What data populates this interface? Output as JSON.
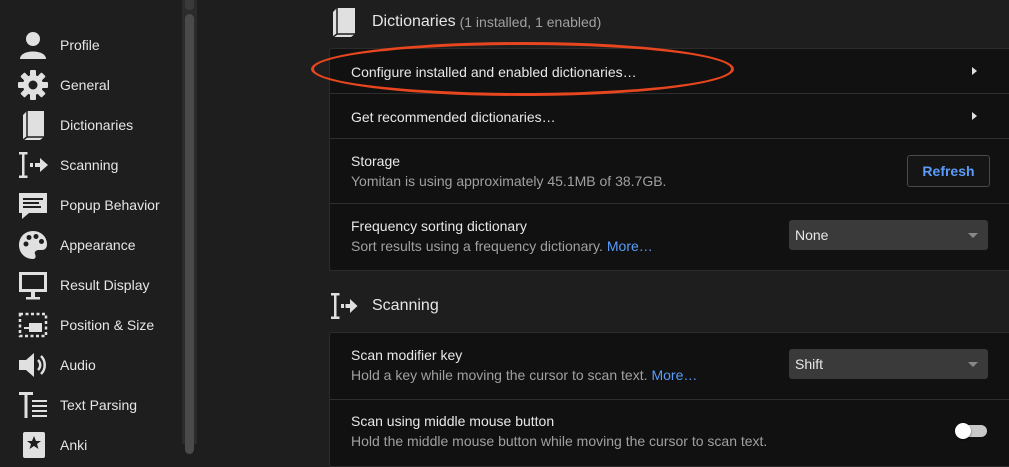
{
  "sidebar": {
    "items": [
      {
        "label": "Profile",
        "icon": "profile-icon"
      },
      {
        "label": "General",
        "icon": "gear-icon"
      },
      {
        "label": "Dictionaries",
        "icon": "book-icon"
      },
      {
        "label": "Scanning",
        "icon": "scanning-icon"
      },
      {
        "label": "Popup Behavior",
        "icon": "popup-icon"
      },
      {
        "label": "Appearance",
        "icon": "palette-icon"
      },
      {
        "label": "Result Display",
        "icon": "monitor-icon"
      },
      {
        "label": "Position & Size",
        "icon": "position-icon"
      },
      {
        "label": "Audio",
        "icon": "speaker-icon"
      },
      {
        "label": "Text Parsing",
        "icon": "text-parsing-icon"
      },
      {
        "label": "Anki",
        "icon": "anki-icon"
      }
    ]
  },
  "dictionaries": {
    "title": "Dictionaries",
    "subtitle": "(1 installed, 1 enabled)",
    "configure_label": "Configure installed and enabled dictionaries…",
    "recommended_label": "Get recommended dictionaries…",
    "storage_title": "Storage",
    "storage_desc": "Yomitan is using approximately 45.1MB of 38.7GB.",
    "refresh_label": "Refresh",
    "freq_title": "Frequency sorting dictionary",
    "freq_desc": "Sort results using a frequency dictionary.",
    "freq_more": "More…",
    "freq_value": "None"
  },
  "scanning": {
    "title": "Scanning",
    "modifier_title": "Scan modifier key",
    "modifier_desc": "Hold a key while moving the cursor to scan text.",
    "modifier_more": "More…",
    "modifier_value": "Shift",
    "middle_title": "Scan using middle mouse button",
    "middle_desc": "Hold the middle mouse button while moving the cursor to scan text.",
    "middle_enabled": false
  },
  "colors": {
    "accent": "#5a9cf8",
    "highlight": "#e8461f"
  }
}
